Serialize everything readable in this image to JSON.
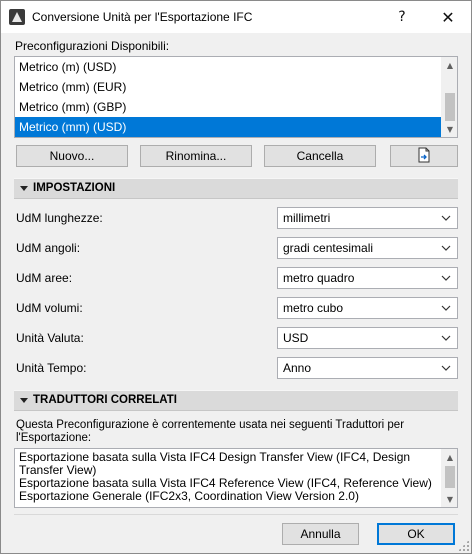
{
  "window": {
    "title": "Conversione Unità per l'Esportazione IFC",
    "help_glyph": "?",
    "close_glyph": "✕"
  },
  "presets": {
    "label": "Preconfigurazioni Disponibili:",
    "items": [
      {
        "label": "Metrico (m) (USD)",
        "selected": false
      },
      {
        "label": "Metrico (mm) (EUR)",
        "selected": false
      },
      {
        "label": "Metrico (mm) (GBP)",
        "selected": false
      },
      {
        "label": "Metrico (mm) (USD)",
        "selected": true
      }
    ]
  },
  "buttons": {
    "new": "Nuovo...",
    "rename": "Rinomina...",
    "delete": "Cancella",
    "ok": "OK",
    "cancel": "Annulla"
  },
  "settings": {
    "header": "IMPOSTAZIONI",
    "rows": [
      {
        "label": "UdM lunghezze:",
        "value": "millimetri"
      },
      {
        "label": "UdM angoli:",
        "value": "gradi centesimali"
      },
      {
        "label": "UdM aree:",
        "value": "metro quadro"
      },
      {
        "label": "UdM volumi:",
        "value": "metro cubo"
      },
      {
        "label": "Unità Valuta:",
        "value": "USD"
      },
      {
        "label": "Unità Tempo:",
        "value": "Anno"
      }
    ]
  },
  "translators": {
    "header": "TRADUTTORI CORRELATI",
    "description_line1": "Questa Preconfigurazione è correntemente usata nei seguenti Traduttori per",
    "description_line2": "l'Esportazione:",
    "items": [
      "Esportazione basata sulla Vista IFC4 Design Transfer View (IFC4, Design Transfer View)",
      "Esportazione basata sulla Vista IFC4 Reference View (IFC4, Reference View)",
      "Esportazione Generale (IFC2x3, Coordination View Version 2.0)"
    ]
  },
  "icons": {
    "app": "archicad-icon",
    "dropdown": "chevron-down-icon",
    "import": "import-file-icon",
    "section_toggle": "triangle-down-icon"
  },
  "colors": {
    "selection": "#0078d7",
    "section_bg": "#dadada",
    "dialog_bg": "#f0f0f0"
  }
}
